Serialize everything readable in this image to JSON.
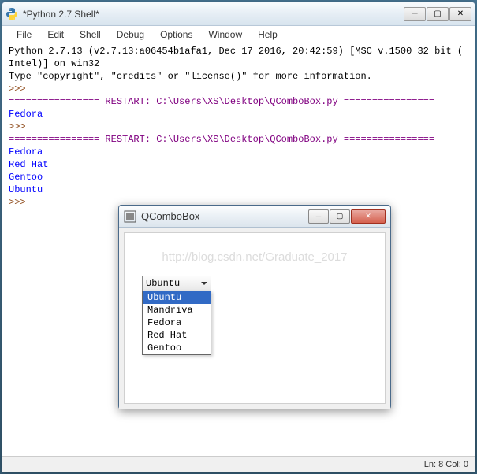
{
  "outer": {
    "title": "*Python 2.7 Shell*",
    "menu": [
      "File",
      "Edit",
      "Shell",
      "Debug",
      "Options",
      "Window",
      "Help"
    ],
    "status": "Ln: 8  Col: 0"
  },
  "console": {
    "header1": "Python 2.7.13 (v2.7.13:a06454b1afa1, Dec 17 2016, 20:42:59) [MSC v.1500 32 bit (",
    "header2": "Intel)] on win32",
    "header3": "Type \"copyright\", \"credits\" or \"license()\" for more information.",
    "prompt": ">>> ",
    "restart1": "================ RESTART: C:\\Users\\XS\\Desktop\\QComboBox.py ================",
    "out1": "Fedora",
    "restart2": "================ RESTART: C:\\Users\\XS\\Desktop\\QComboBox.py ================",
    "out2_1": "Fedora",
    "out2_2": "Red Hat",
    "out2_3": "Gentoo",
    "out2_4": "Ubuntu"
  },
  "inner": {
    "title": "QComboBox",
    "watermark": "http://blog.csdn.net/Graduate_2017",
    "combo": {
      "selected": "Ubuntu",
      "options": [
        "Ubuntu",
        "Mandriva",
        "Fedora",
        "Red Hat",
        "Gentoo"
      ]
    }
  },
  "icons": {
    "minimize": "─",
    "maximize": "☐",
    "close": "✕",
    "python": "🐍",
    "app": "▣"
  }
}
